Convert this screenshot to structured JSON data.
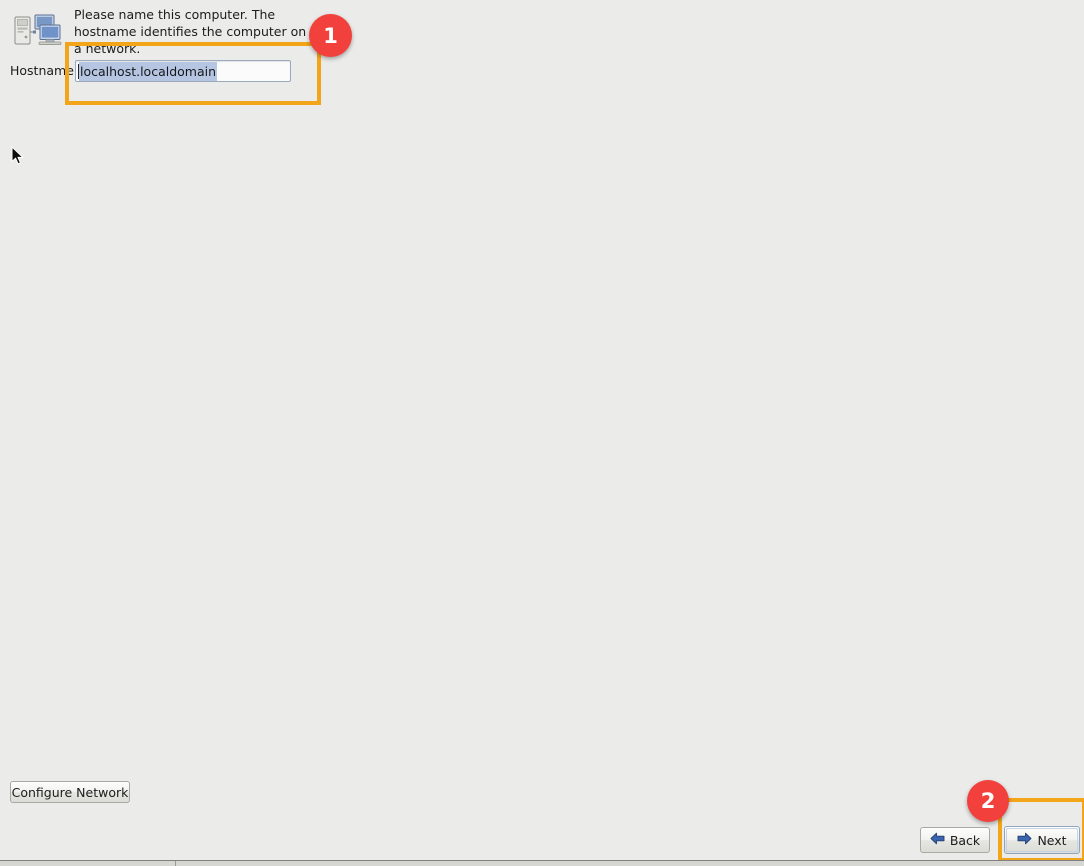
{
  "screen": {
    "background_color": "#ebebe9",
    "accent_highlight_color": "#f3a51a",
    "badge_color": "#f2413c"
  },
  "hostname_section": {
    "icon_name": "network-computers-icon",
    "instruction": "Please name this computer.  The hostname identifies the computer on a network.",
    "label": "Hostname:",
    "input": {
      "value": "localhost.localdomain",
      "placeholder": "localhost.localdomain",
      "selected": true
    }
  },
  "annotations": {
    "badges": [
      {
        "id": "badge-1",
        "label": "1",
        "target": "hostname-input"
      },
      {
        "id": "badge-2",
        "label": "2",
        "target": "next-button"
      }
    ]
  },
  "actions": {
    "configure_network_label": "Configure Network",
    "back_label": "Back",
    "next_label": "Next"
  },
  "icons": {
    "back_arrow": "arrow-left-icon",
    "next_arrow": "arrow-right-icon",
    "cursor": "mouse-pointer-icon"
  }
}
